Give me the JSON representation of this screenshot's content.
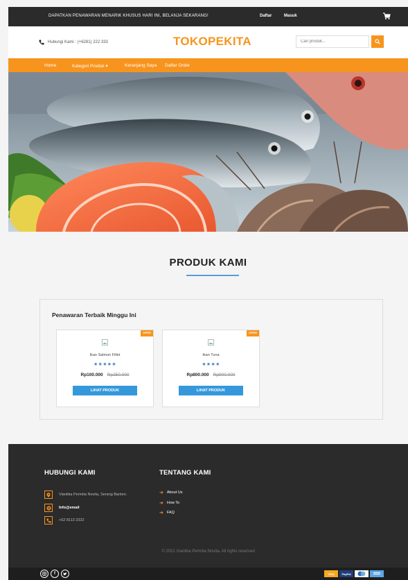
{
  "topbar": {
    "promo": "DAPATKAN PENAWARAN MENARIK KHUSUS HARI INI, BELANJA SEKARANG!",
    "daftar": "Daftar",
    "masuk": "Masuk"
  },
  "header": {
    "phone": "Hubungi Kami : (+6281) 222 333",
    "logo": "TOKOPEKITA",
    "search_placeholder": "Cari produk..."
  },
  "nav": {
    "home": "Home",
    "category": "Kategori Produk",
    "cart": "Keranjang Saya",
    "orders": "Daftar Order"
  },
  "products_section": {
    "title": "PRODUK KAMI",
    "offer_title": "Penawaran Terbaik Minggu Ini"
  },
  "products": [
    {
      "badge": "OFFER",
      "name": "Ikan Salmon Fillet",
      "stars": "★★★★★",
      "price": "Rp100.000",
      "old_price": "Rp250.000",
      "button": "LIHAT PRODUK"
    },
    {
      "badge": "OFFER",
      "name": "Ikan Tuna",
      "stars": "★★★★",
      "price": "Rp800.000",
      "old_price": "Rp900.000",
      "button": "LIHAT PRODUK"
    }
  ],
  "footer": {
    "contact_title": "HUBUNGI KAMI",
    "address": "Viantika Permita Novita, Serang Banten.",
    "email": "Info@email",
    "phone": "+62 8113 2322",
    "about_title": "TENTANG KAMI",
    "about_links": [
      "About Us",
      "How To",
      "FAQ"
    ],
    "copyright": "© 2021 Viantika Permita Novita. All rights reserved"
  },
  "payments": {
    "visa": "VISA",
    "paypal": "PayPal"
  },
  "colors": {
    "accent": "#f7941d",
    "dark": "#2b2b2b",
    "button": "#3498db"
  }
}
